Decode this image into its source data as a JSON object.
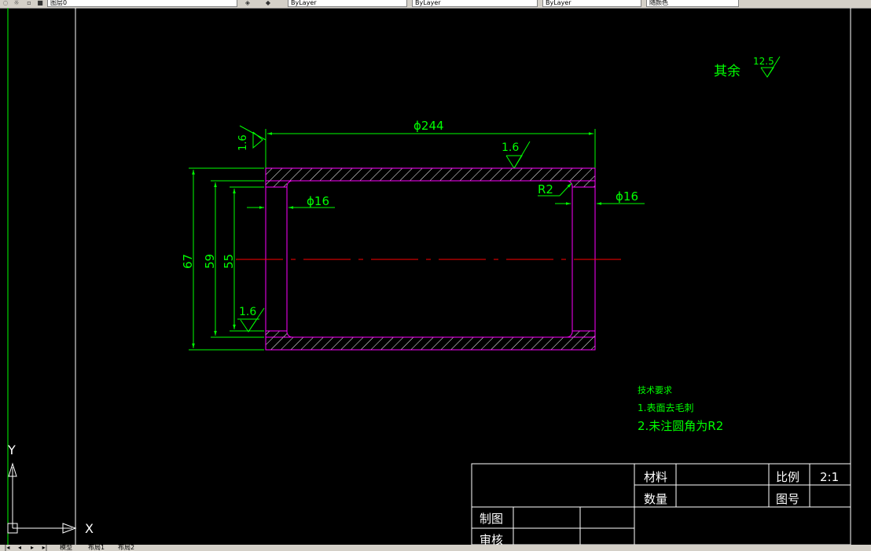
{
  "toolbar": {
    "layer_label": "图层0",
    "style_1": "ByLayer",
    "style_2": "ByLayer",
    "style_3": "ByLayer",
    "color_label": "随颜色"
  },
  "drawing": {
    "note_remaining": "其余",
    "rough_global": "12.5",
    "dim_outer_dia": "ϕ244",
    "rough_left_face": "1.6",
    "rough_top": "1.6",
    "dim_fillet": "R2",
    "dim_left_step": "ϕ16",
    "dim_right_step": "ϕ16",
    "dim_67": "67",
    "dim_59": "59",
    "dim_55": "55",
    "rough_bore": "1.6"
  },
  "tech_req": {
    "title": "技术要求",
    "item1": "1.表面去毛刺",
    "item2": "2.未注圆角为R2"
  },
  "title_block": {
    "material_label": "材料",
    "scale_label": "比例",
    "scale_value": "2:1",
    "quantity_label": "数量",
    "drawing_no_label": "图号",
    "drawn_label": "制图",
    "checked_label": "审核"
  },
  "ucs": {
    "x_label": "X",
    "y_label": "Y"
  },
  "bottom_tabs": {
    "model": "模型",
    "layout1": "布局1",
    "layout2": "布局2"
  },
  "colors": {
    "green": "#00ff00",
    "magenta": "#ff00ff",
    "red": "#ff0000",
    "white": "#ffffff",
    "background": "#000000"
  },
  "icons": [
    "layer-icon",
    "color-icon",
    "nav-first-icon",
    "nav-prev-icon",
    "nav-next-icon",
    "nav-last-icon"
  ]
}
